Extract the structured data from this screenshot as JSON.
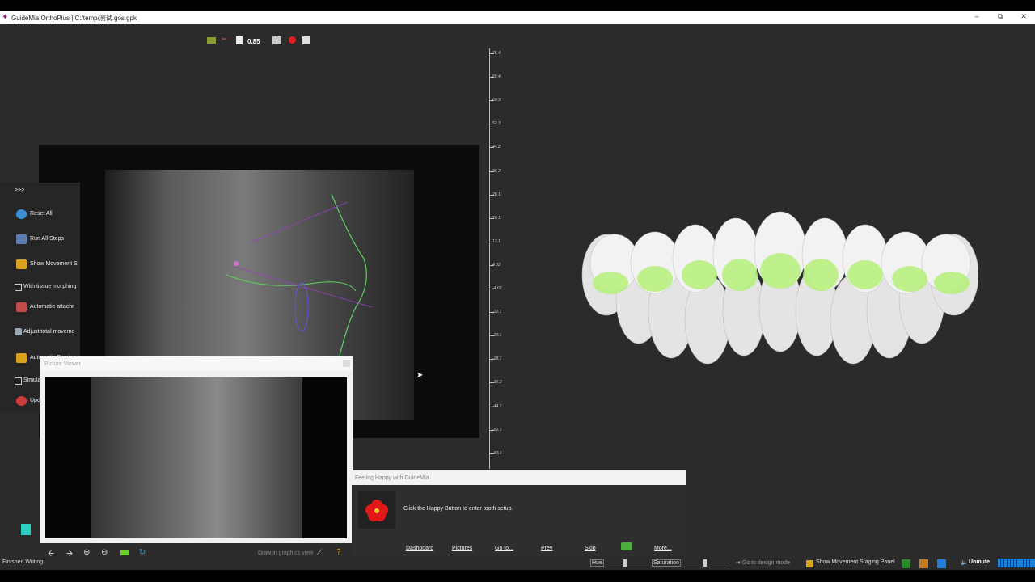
{
  "window": {
    "title": "GuideMia OrthoPlus | C:/temp/测试.gos.gpk",
    "minimize": "–",
    "maximize": "⧉",
    "close": "✕"
  },
  "toolbar": {
    "zoom_value": "0.85"
  },
  "ruler": {
    "labels": [
      "76.4",
      "68.4",
      "60.3",
      "52.3",
      "44.2",
      "36.2",
      "28.1",
      "20.1",
      "12.1",
      "4.02",
      "-4.02",
      "-12.1",
      "-20.1",
      "-28.1",
      "-36.2",
      "-44.2",
      "-52.3",
      "-60.3"
    ]
  },
  "side_panel": {
    "expand": ">>>",
    "items": [
      {
        "label": "Reset All",
        "type": "button",
        "icon_color": "#3a8fd9"
      },
      {
        "label": "Run All Steps",
        "type": "button",
        "icon_color": "#5a7fb0"
      },
      {
        "label": "Show Movement S",
        "type": "button",
        "icon_color": "#d9a21f"
      },
      {
        "label": "With tissue morphing",
        "type": "checkbox"
      },
      {
        "label": "Automatic attachr",
        "type": "button",
        "icon_color": "#c24a4a"
      },
      {
        "label": "Adjust total moveme",
        "type": "button",
        "icon_color": "#9aa7b5"
      },
      {
        "label": "Automatic Staging",
        "type": "button",
        "icon_color": "#d9a21f"
      },
      {
        "label": "Simulate Occlusal Ch",
        "type": "checkbox"
      },
      {
        "label": "Update Occlusal C",
        "type": "button",
        "icon_color": "#d13a3a"
      }
    ]
  },
  "picture_viewer": {
    "title": "Picture Viewer",
    "draw_label": "Draw in graphics view",
    "help": "?"
  },
  "happy_dialog": {
    "title": "Feeling Happy with GuideMia",
    "message": "Click the Happy Button to enter tooth setup.",
    "links": [
      "Dashboard",
      "Pictures",
      "Go to...",
      "Prev",
      "Skip",
      "More..."
    ]
  },
  "status_bar": {
    "message": "Finished Writing",
    "hue_label": "Hue",
    "saturation_label": "Saturation",
    "design_mode": "Go to design mode",
    "movement_panel": "Show Movement Staging Panel",
    "unmute": "Unmute"
  },
  "colors": {
    "workspace": "#2b2b2b",
    "tracing_green": "#5fd05f",
    "tracing_purple": "#9b3fc9",
    "tooth_highlight": "#b5f07a",
    "accent_blue": "#1e7fd8"
  }
}
